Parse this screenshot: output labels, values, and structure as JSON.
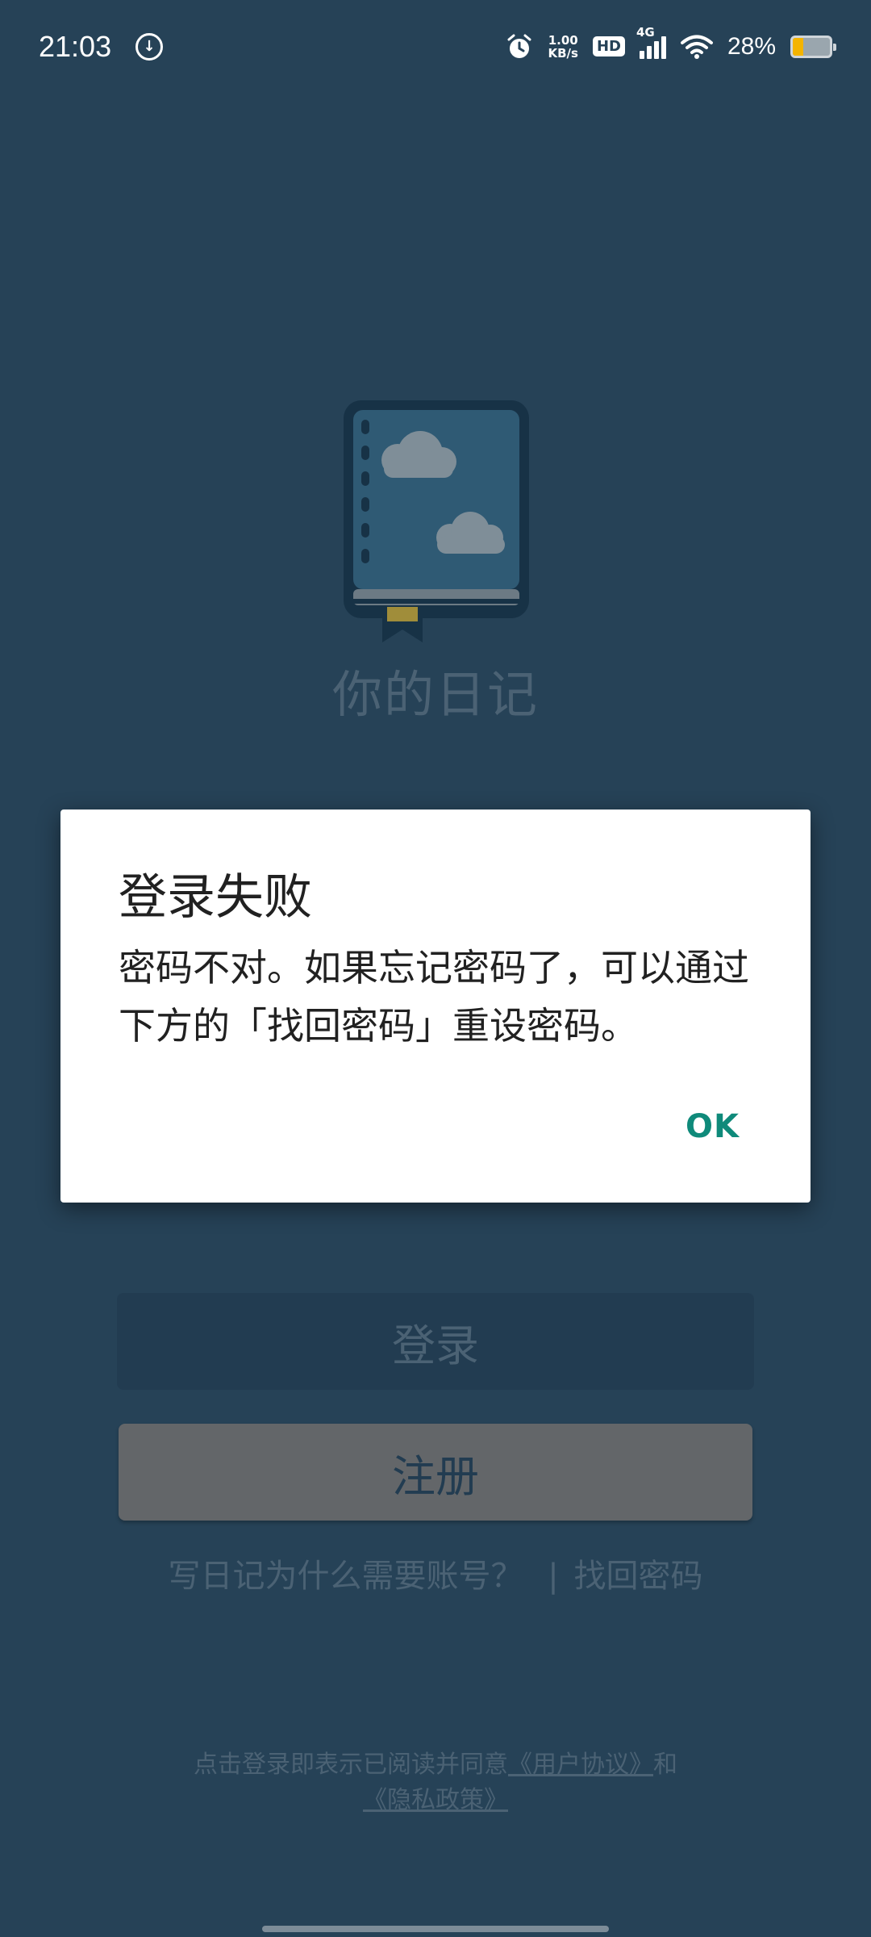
{
  "status_bar": {
    "time": "21:03",
    "net_speed_value": "1.00",
    "net_speed_unit": "KB/s",
    "hd": "HD",
    "network_gen": "4G",
    "battery_percent": "28%"
  },
  "app": {
    "title": "你的日记"
  },
  "buttons": {
    "login": "登录",
    "register": "注册"
  },
  "links": {
    "why_account": "写日记为什么需要账号？",
    "separator": "|",
    "recover_password": "找回密码"
  },
  "agreement": {
    "prefix": "点击登录即表示已阅读并同意",
    "user_agreement": "《用户协议》",
    "and": "和",
    "privacy_policy": "《隐私政策》"
  },
  "dialog": {
    "title": "登录失败",
    "message": "密码不对。如果忘记密码了，可以通过下方的「找回密码」重设密码。",
    "ok_label": "OK"
  },
  "colors": {
    "background": "#264257",
    "dialog_accent": "#0f8a7a"
  }
}
